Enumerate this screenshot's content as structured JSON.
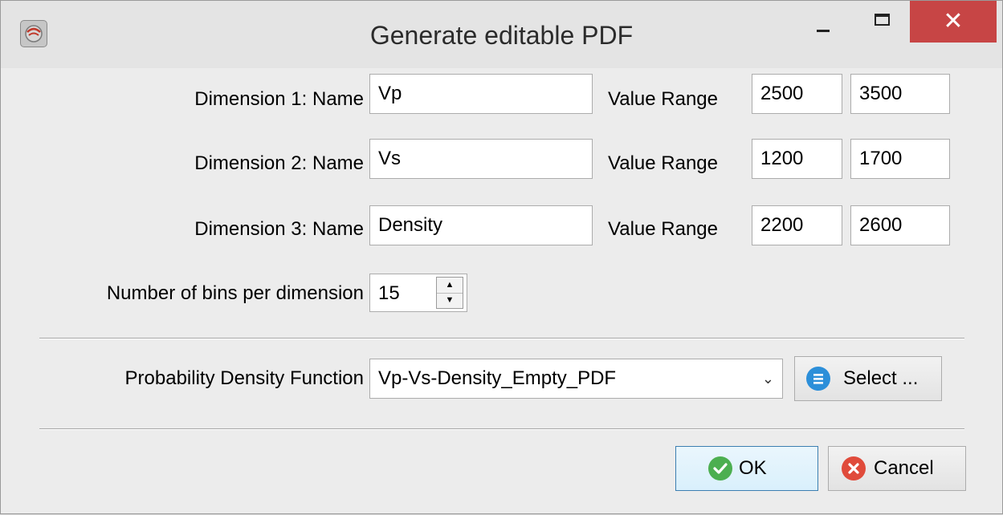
{
  "window": {
    "title": "Generate editable PDF",
    "close_glyph": "✕"
  },
  "dimensions": [
    {
      "label": "Dimension 1: Name",
      "name": "Vp",
      "range_label": "Value Range",
      "min": "2500",
      "max": "3500"
    },
    {
      "label": "Dimension 2: Name",
      "name": "Vs",
      "range_label": "Value Range",
      "min": "1200",
      "max": "1700"
    },
    {
      "label": "Dimension 3: Name",
      "name": "Density",
      "range_label": "Value Range",
      "min": "2200",
      "max": "2600"
    }
  ],
  "bins": {
    "label": "Number of bins per dimension",
    "value": "15"
  },
  "pdf": {
    "label": "Probability Density Function",
    "selected": "Vp-Vs-Density_Empty_PDF",
    "select_button": "Select ..."
  },
  "buttons": {
    "ok": "OK",
    "cancel": "Cancel"
  },
  "icons": {
    "app": "app-logo-icon",
    "list": "list-icon",
    "ok": "check-circle-icon",
    "cancel": "x-circle-icon",
    "dropdown": "chevron-down-icon"
  },
  "colors": {
    "close_button": "#c74545",
    "list_icon": "#2c8fd9",
    "ok_icon": "#4caf50",
    "cancel_icon": "#e04b3b"
  }
}
